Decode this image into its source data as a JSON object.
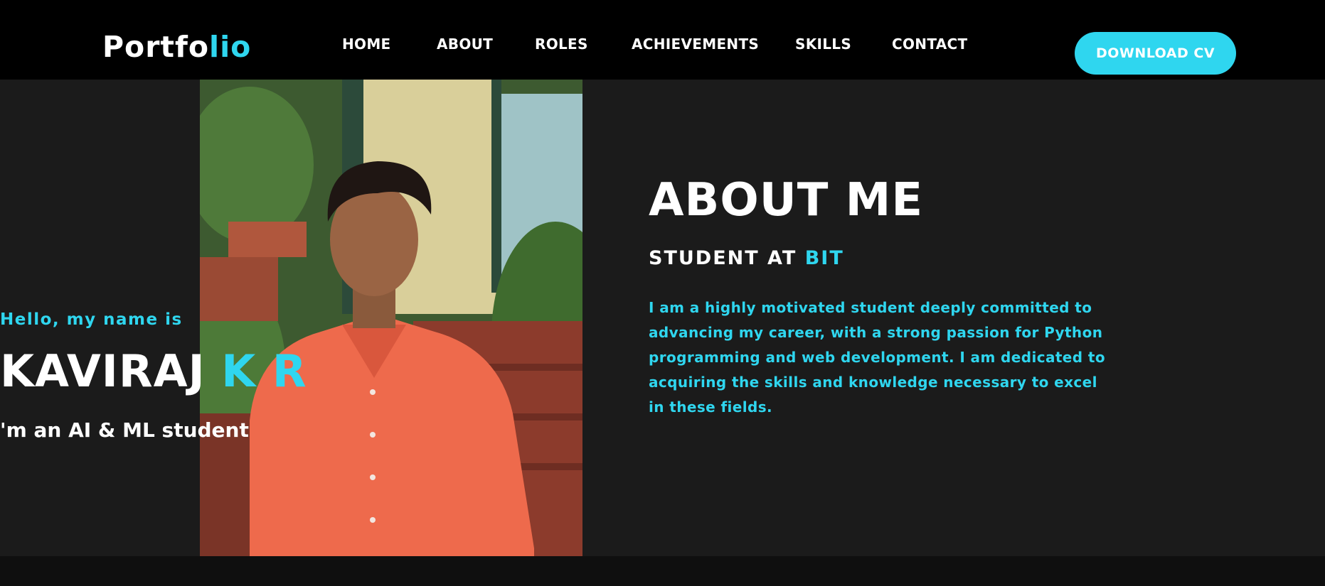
{
  "header": {
    "logo_main": "Portfo",
    "logo_accent": "lio",
    "nav": [
      "HOME",
      "ABOUT",
      "ROLES",
      "ACHIEVEMENTS",
      "SKILLS",
      "CONTACT"
    ],
    "cta_label": "DOWNLOAD CV"
  },
  "hero": {
    "greeting": "Hello, my name is",
    "first_name": "KAVIRAJ",
    "last_name": "K R",
    "tagline": "'m an AI & ML student"
  },
  "about": {
    "title": "ABOUT ME",
    "subtitle_prefix": "STUDENT AT",
    "subtitle_accent": "BIT",
    "body": "I am a highly motivated student deeply committed to advancing my career, with a strong passion for Python programming and web development. I am dedicated to acquiring the skills and knowledge necessary to excel in these fields."
  },
  "colors": {
    "accent": "#2fd6ef",
    "header_bg": "#000000",
    "page_bg": "#1b1b1b"
  }
}
